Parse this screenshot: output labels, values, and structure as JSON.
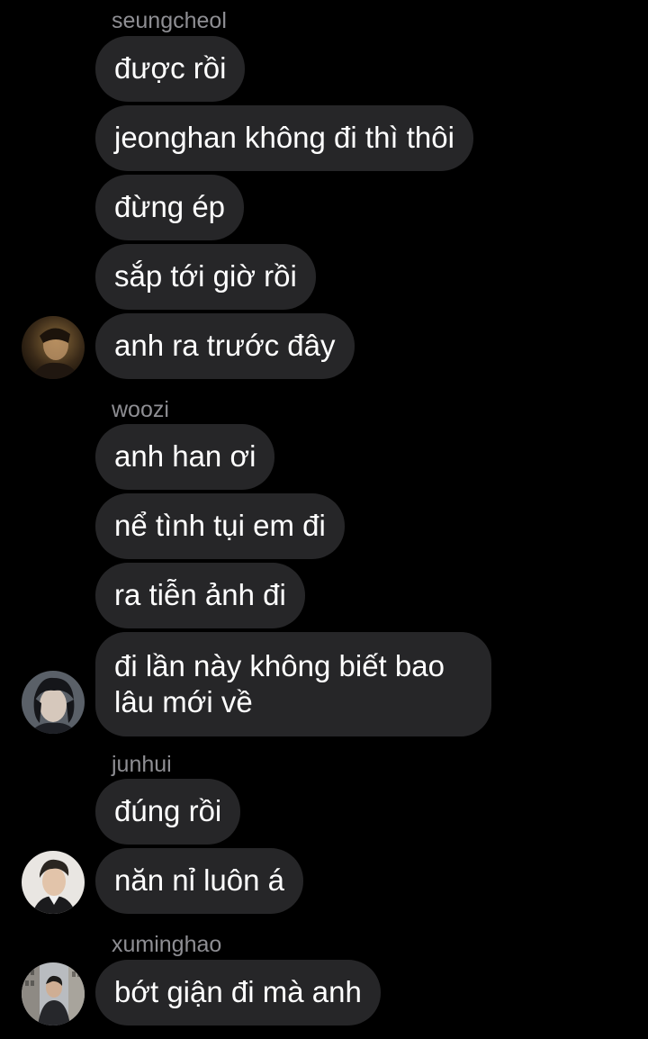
{
  "groups": [
    {
      "sender": "seungcheol",
      "messages": [
        "được rồi",
        "jeonghan không đi thì thôi",
        "đừng ép",
        "sắp tới giờ rồi",
        "anh ra trước đây"
      ],
      "avatar_icon": "user-avatar-seungcheol"
    },
    {
      "sender": "woozi",
      "messages": [
        "anh han ơi",
        "nể tình tụi em đi",
        "ra tiễn ảnh đi",
        "đi lần này không biết bao lâu mới về"
      ],
      "avatar_icon": "user-avatar-woozi"
    },
    {
      "sender": "junhui",
      "messages": [
        "đúng rồi",
        "năn nỉ luôn á"
      ],
      "avatar_icon": "user-avatar-junhui"
    },
    {
      "sender": "xuminghao",
      "messages": [
        "bớt giận đi mà anh"
      ],
      "avatar_icon": "user-avatar-xuminghao"
    }
  ],
  "colors": {
    "background": "#000000",
    "bubble": "#262628",
    "message_text": "#ffffff",
    "sender_text": "#8e8e93"
  }
}
